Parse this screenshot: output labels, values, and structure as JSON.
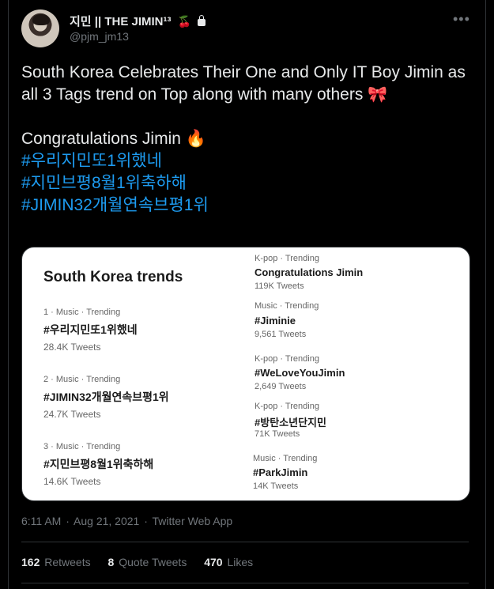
{
  "author": {
    "display_name": "지민 || THE JIMIN¹³",
    "handle": "@pjm_jm13",
    "name_emoji": "🍒"
  },
  "tweet": {
    "line1": "South Korea Celebrates Their One and Only IT Boy Jimin as all 3 Tags trend on Top along with many others",
    "ribbon_emoji": "🎀",
    "line2": "Congratulations Jimin",
    "fire_emoji": "🔥",
    "hashtags": [
      "#우리지민또1위했네",
      "#지민브평8월1위축하해",
      "#JIMIN32개월연속브평1위"
    ]
  },
  "card": {
    "title": "South Korea trends",
    "left_trends": [
      {
        "meta": "1 · Music · Trending",
        "tag": "#우리지민또1위했네",
        "count": "28.4K Tweets"
      },
      {
        "meta": "2 · Music · Trending",
        "tag": "#JIMIN32개월연속브평1위",
        "count": "24.7K Tweets"
      },
      {
        "meta": "3 · Music · Trending",
        "tag": "#지민브평8월1위축하해",
        "count": "14.6K Tweets"
      }
    ],
    "right_trends": [
      {
        "meta": "K-pop · Trending",
        "tag": "Congratulations Jimin",
        "count": "119K Tweets"
      },
      {
        "meta": "Music · Trending",
        "tag": "#Jiminie",
        "count": "9,561 Tweets"
      },
      {
        "meta": "K-pop · Trending",
        "tag": "#WeLoveYouJimin",
        "count": "2,649 Tweets"
      },
      {
        "meta": "K-pop · Trending",
        "tag": "#방탄소년단지민",
        "count": "71K Tweets"
      },
      {
        "meta": "Music · Trending",
        "tag": "#ParkJimin",
        "count": "14K Tweets"
      }
    ]
  },
  "footer": {
    "time": "6:11 AM",
    "date": "Aug 21, 2021",
    "source": "Twitter Web App",
    "retweets_count": "162",
    "retweets_label": "Retweets",
    "quotes_count": "8",
    "quotes_label": "Quote Tweets",
    "likes_count": "470",
    "likes_label": "Likes"
  },
  "colors": {
    "background": "#000000",
    "text": "#e7e9ea",
    "muted": "#71767b",
    "link": "#1d9bf0",
    "border": "#2f3336"
  }
}
